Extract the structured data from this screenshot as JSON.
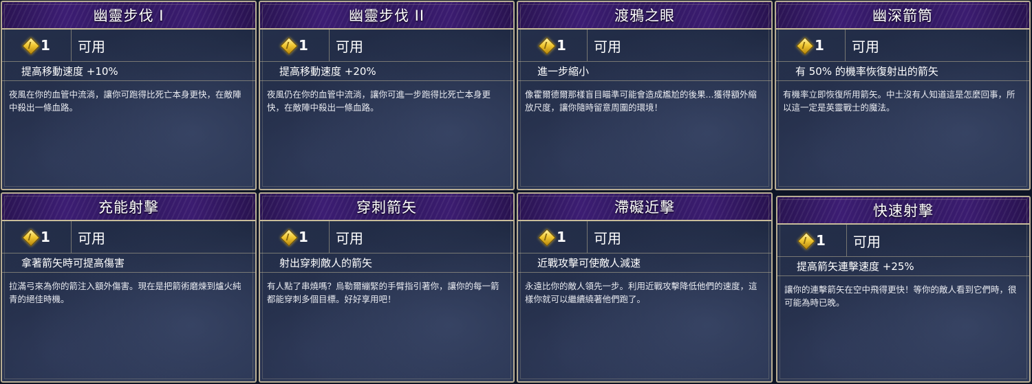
{
  "cards": [
    {
      "title": "幽靈步伐 I",
      "cost": "1",
      "status": "可用",
      "effect": "提高移動速度 +10%",
      "description": "夜風在你的血管中流淌，讓你可跑得比死亡本身更快，在敵陣中殺出一條血路。"
    },
    {
      "title": "幽靈步伐 II",
      "cost": "1",
      "status": "可用",
      "effect": "提高移動速度 +20%",
      "description": "夜風仍在你的血管中流淌，讓你可進一步跑得比死亡本身更快，在敵陣中殺出一條血路。"
    },
    {
      "title": "渡鴉之眼",
      "cost": "1",
      "status": "可用",
      "effect": "進一步縮小",
      "description": "像霍爾德爾那樣盲目瞄準可能會造成尷尬的後果...獲得額外縮放尺度，讓你隨時留意周圍的環境！"
    },
    {
      "title": "幽深箭筒",
      "cost": "1",
      "status": "可用",
      "effect": "有 50% 的機率恢復射出的箭矢",
      "description": "有機率立即恢復所用箭矢。中土沒有人知道這是怎麼回事，所以這一定是英靈戰士的魔法。"
    },
    {
      "title": "充能射擊",
      "cost": "1",
      "status": "可用",
      "effect": "拿著箭矢時可提高傷害",
      "description": "拉滿弓來為你的箭注入額外傷害。現在是把箭術磨煉到爐火純青的絕佳時機。"
    },
    {
      "title": "穿刺箭矢",
      "cost": "1",
      "status": "可用",
      "effect": "射出穿刺敵人的箭矢",
      "description": "有人點了串燒嗎？烏勒爾繃緊的手臂指引著你，讓你的每一箭都能穿刺多個目標。好好享用吧！"
    },
    {
      "title": "滯礙近擊",
      "cost": "1",
      "status": "可用",
      "effect": "近戰攻擊可使敵人減速",
      "description": "永遠比你的敵人領先一步。利用近戰攻擊降低他們的速度，這樣你就可以繼續繞著他們跑了。"
    },
    {
      "title": "快速射擊",
      "cost": "1",
      "status": "可用",
      "effect": "提高箭矢連擊速度 +25%",
      "description": "讓你的連擊箭矢在空中飛得更快！等你的敵人看到它們時，很可能為時已晚。"
    }
  ]
}
